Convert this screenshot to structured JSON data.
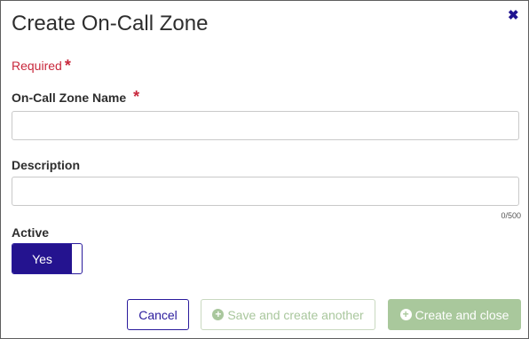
{
  "dialog": {
    "title": "Create On-Call Zone",
    "close_icon": "close-icon",
    "required_note": "Required",
    "required_marker": "*"
  },
  "fields": {
    "name": {
      "label": "On-Call Zone Name",
      "value": "",
      "placeholder": ""
    },
    "description": {
      "label": "Description",
      "value": "",
      "placeholder": "",
      "counter": "0/500"
    },
    "active": {
      "label": "Active",
      "value": "Yes"
    }
  },
  "buttons": {
    "cancel": "Cancel",
    "save_another": "Save and create another",
    "create_close": "Create and close",
    "plus_icon": "plus-circle-icon"
  },
  "colors": {
    "accent": "#24138f",
    "required": "#c8283c",
    "disabled_green": "#a9c89c"
  }
}
